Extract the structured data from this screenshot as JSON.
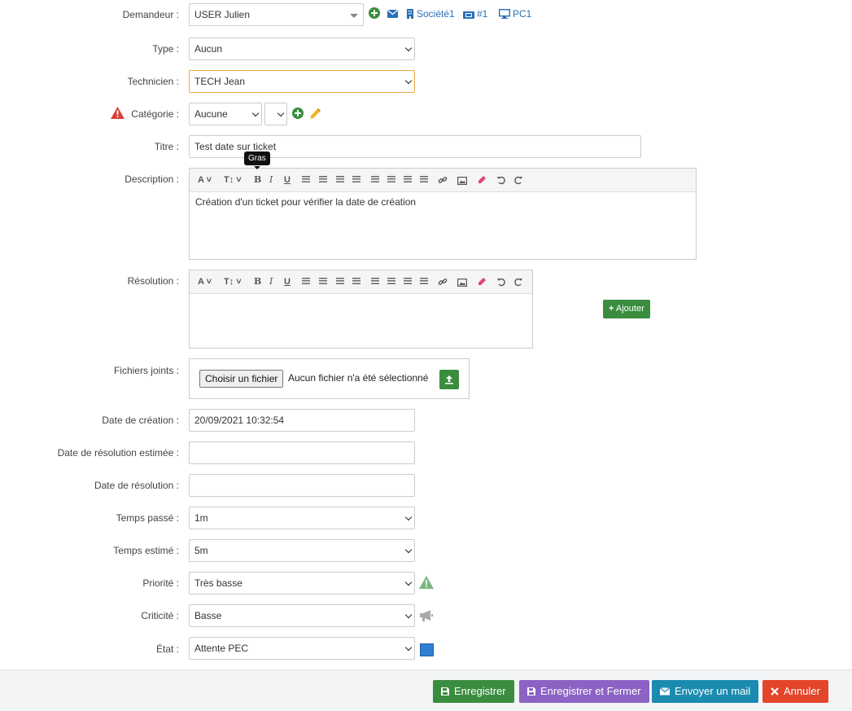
{
  "fields": {
    "demandeur": {
      "label": "Demandeur :",
      "value": "USER Julien"
    },
    "societe": "Société1",
    "ticket_ref": "#1",
    "pc": "PC1",
    "type": {
      "label": "Type :",
      "value": "Aucun"
    },
    "technicien": {
      "label": "Technicien :",
      "value": "TECH Jean"
    },
    "categorie": {
      "label": "Catégorie :",
      "value": "Aucune"
    },
    "titre": {
      "label": "Titre :",
      "value": "Test date sur ticket"
    },
    "description": {
      "label": "Description :",
      "content": "Création d'un ticket pour vérifier la date de création",
      "tooltip": "Gras"
    },
    "resolution": {
      "label": "Résolution :",
      "content": "",
      "add_button": "Ajouter"
    },
    "fichiers": {
      "label": "Fichiers joints :",
      "choose_button": "Choisir un fichier",
      "status": "Aucun fichier n'a été sélectionné"
    },
    "date_creation": {
      "label": "Date de création :",
      "value": "20/09/2021 10:32:54"
    },
    "date_resolution_estimee": {
      "label": "Date de résolution estimée :",
      "value": ""
    },
    "date_resolution": {
      "label": "Date de résolution :",
      "value": ""
    },
    "temps_passe": {
      "label": "Temps passé :",
      "value": "1m"
    },
    "temps_estime": {
      "label": "Temps estimé :",
      "value": "5m"
    },
    "priorite": {
      "label": "Priorité :",
      "value": "Très basse"
    },
    "criticite": {
      "label": "Criticité :",
      "value": "Basse"
    },
    "etat": {
      "label": "État :",
      "value": "Attente PEC",
      "color": "#2f7fd3"
    }
  },
  "toolbar": {
    "font_label": "A",
    "size_label": "T↕",
    "bold": "B",
    "italic": "I",
    "underline": "U"
  },
  "footer": {
    "save": "Enregistrer",
    "save_close": "Enregistrer et Fermer",
    "send_mail": "Envoyer un mail",
    "cancel": "Annuler"
  },
  "colors": {
    "green": "#3a8d3f",
    "purple": "#8c63c4",
    "teal": "#1b8bb0",
    "red": "#e2452a",
    "link": "#2a6fb6"
  }
}
